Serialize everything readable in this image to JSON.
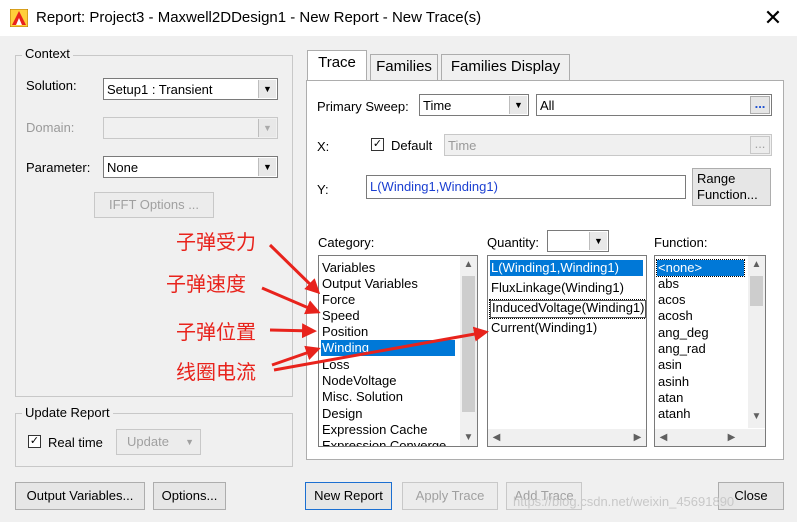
{
  "window": {
    "title": "Report: Project3 - Maxwell2DDesign1 - New Report - New Trace(s)",
    "close_glyph": "✕"
  },
  "context": {
    "legend": "Context",
    "solution_label": "Solution:",
    "solution_value": "Setup1 : Transient",
    "domain_label": "Domain:",
    "domain_value": "",
    "parameter_label": "Parameter:",
    "parameter_value": "None",
    "ifft_button": "IFFT Options ..."
  },
  "update_report": {
    "legend": "Update Report",
    "realtime_label": "Real time",
    "realtime_checked": true,
    "update_button": "Update"
  },
  "tabs": [
    {
      "label": "Trace",
      "active": true
    },
    {
      "label": "Families",
      "active": false
    },
    {
      "label": "Families Display",
      "active": false
    }
  ],
  "trace": {
    "primary_sweep_label": "Primary Sweep:",
    "primary_sweep_value": "Time",
    "sweep_range_value": "All",
    "ellipsis": "...",
    "x_label": "X:",
    "default_label": "Default",
    "default_checked": true,
    "x_value": "Time",
    "y_label": "Y:",
    "y_value": "L(Winding1,Winding1)",
    "range_function_line1": "Range",
    "range_function_line2": "Function..."
  },
  "category": {
    "label": "Category:",
    "items": [
      "Variables",
      "Output Variables",
      "Force",
      "Speed",
      "Position",
      "Winding",
      "Loss",
      "NodeVoltage",
      "Misc. Solution",
      "Design",
      "Expression Cache",
      "Expression Converge"
    ],
    "selected_index": 5
  },
  "quantity": {
    "label": "Quantity:",
    "items": [
      "L(Winding1,Winding1)",
      "FluxLinkage(Winding1)",
      "InducedVoltage(Winding1)",
      "Current(Winding1)"
    ],
    "selected_index": 0,
    "hover_index": 2
  },
  "function": {
    "label": "Function:",
    "items": [
      "<none>",
      "abs",
      "acos",
      "acosh",
      "ang_deg",
      "ang_rad",
      "asin",
      "asinh",
      "atan",
      "atanh"
    ],
    "selected_index": 0
  },
  "annotations": [
    "子弹受力",
    "子弹速度",
    "子弹位置",
    "线圈电流"
  ],
  "annotation_color": "#e8231c",
  "accent_color": "#0078d7",
  "bottom_buttons": {
    "output_variables": "Output Variables...",
    "options": "Options...",
    "new_report": "New Report",
    "apply_trace": "Apply Trace",
    "add_trace": "Add Trace",
    "close": "Close"
  },
  "watermark": "https://blog.csdn.net/weixin_45691890"
}
